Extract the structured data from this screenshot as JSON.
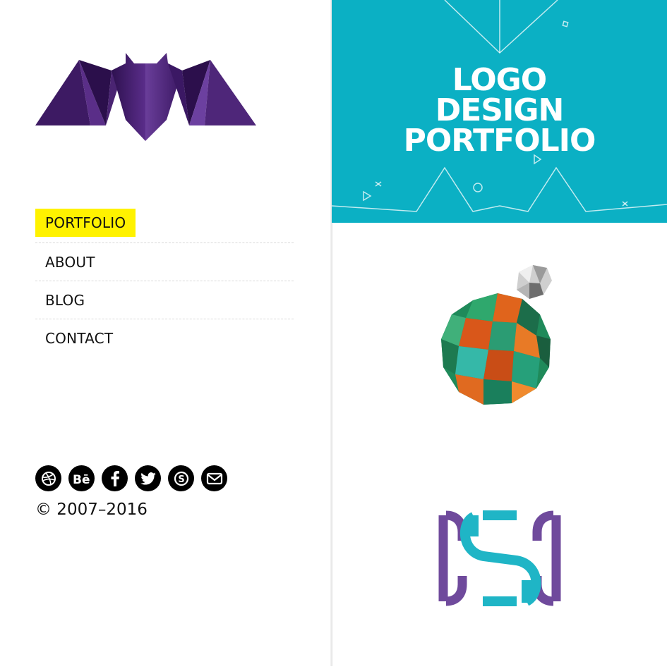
{
  "nav": {
    "items": [
      {
        "label": "PORTFOLIO",
        "active": true
      },
      {
        "label": "ABOUT",
        "active": false
      },
      {
        "label": "BLOG",
        "active": false
      },
      {
        "label": "CONTACT",
        "active": false
      }
    ]
  },
  "social": {
    "icons": [
      "dribbble-icon",
      "behance-icon",
      "facebook-icon",
      "twitter-icon",
      "skype-icon",
      "email-icon"
    ]
  },
  "footer": {
    "copyright": "© 2007–2016"
  },
  "portfolio": {
    "banner": {
      "lines": [
        "LOGO",
        "DESIGN",
        "PORTFOLIO"
      ],
      "background": "#0bb0c4"
    }
  },
  "colors": {
    "accent": "#fff200",
    "logo_purple": "#4a2472",
    "h_purple": "#6f4a9c",
    "h_teal": "#1fb5c6"
  }
}
